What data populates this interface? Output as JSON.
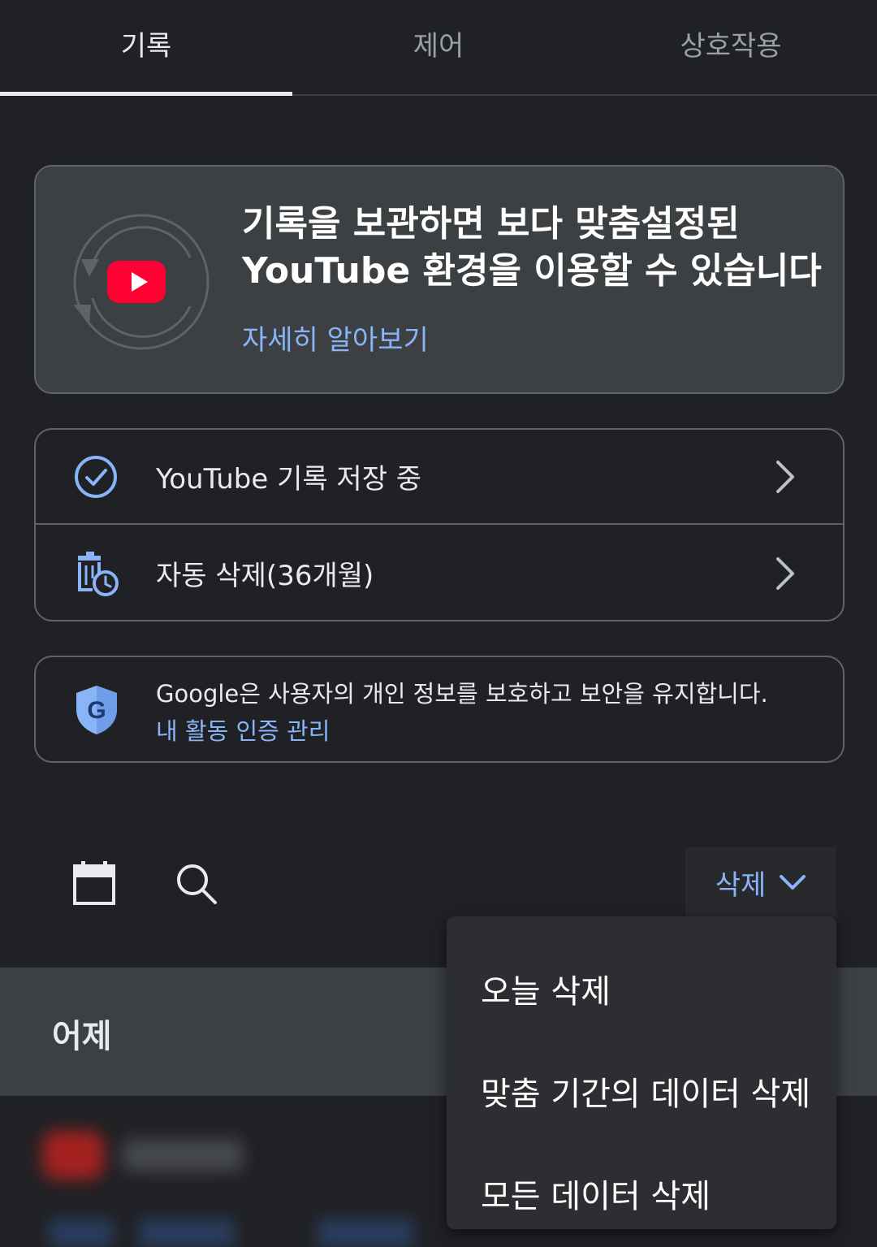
{
  "tabs": [
    {
      "label": "기록",
      "active": true
    },
    {
      "label": "제어",
      "active": false
    },
    {
      "label": "상호작용",
      "active": false
    }
  ],
  "promo": {
    "title_line1": "기록을 보관하면 보다 맞춤설정된",
    "title_line2": "YouTube 환경을 이용할 수 있습니다",
    "link": "자세히 알아보기",
    "icon": "youtube-history-icon"
  },
  "settings": [
    {
      "label": "YouTube 기록 저장 중",
      "icon": "check-circle-icon"
    },
    {
      "label": "자동 삭제(36개월)",
      "icon": "auto-delete-icon"
    }
  ],
  "privacy": {
    "text": "Google은 사용자의 개인 정보를 보호하고 보안을 유지합니다.",
    "link": "내 활동 인증 관리",
    "icon": "google-shield-icon"
  },
  "toolbar": {
    "delete_label": "삭제"
  },
  "day_section": {
    "label": "어제"
  },
  "delete_menu": {
    "items": [
      "오늘 삭제",
      "맞춤 기간의 데이터 삭제",
      "모든 데이터 삭제"
    ]
  },
  "colors": {
    "background": "#202124",
    "card": "#3c4043",
    "link": "#8ab4f8",
    "youtube_red": "#ff0033"
  }
}
